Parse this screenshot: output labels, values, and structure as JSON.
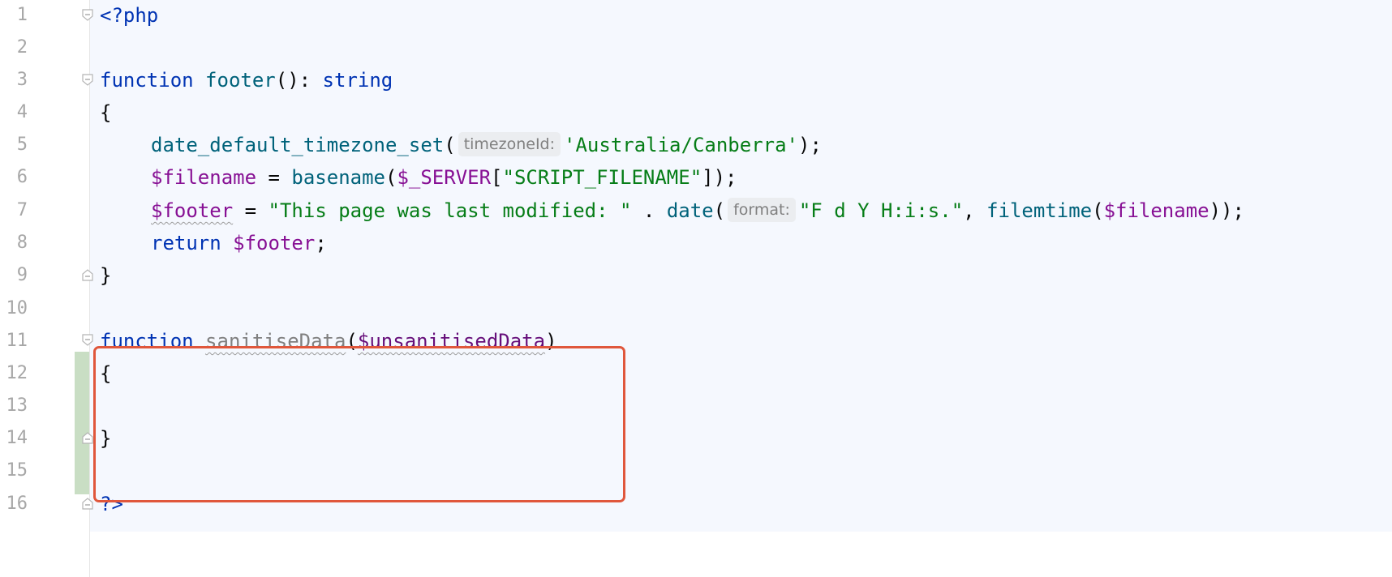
{
  "editor": {
    "language": "PHP",
    "lines": [
      {
        "n": "1"
      },
      {
        "n": "2"
      },
      {
        "n": "3"
      },
      {
        "n": "4"
      },
      {
        "n": "5"
      },
      {
        "n": "6"
      },
      {
        "n": "7"
      },
      {
        "n": "8"
      },
      {
        "n": "9"
      },
      {
        "n": "10"
      },
      {
        "n": "11"
      },
      {
        "n": "12"
      },
      {
        "n": "13"
      },
      {
        "n": "14"
      },
      {
        "n": "15"
      },
      {
        "n": "16"
      }
    ],
    "code": {
      "l1_open_tag": "<?php",
      "l3_function": "function",
      "l3_name": "footer",
      "l3_sig": "(): ",
      "l3_type": "string",
      "l4_brace": "{",
      "l5_call": "date_default_timezone_set",
      "l5_paren": "(",
      "l5_hint": "timezoneId:",
      "l5_arg": "'Australia/Canberra'",
      "l5_end": ");",
      "l6_var": "$filename",
      "l6_eq": " = ",
      "l6_call": "basename",
      "l6_paren": "(",
      "l6_server": "$_SERVER",
      "l6_br_open": "[",
      "l6_key": "\"SCRIPT_FILENAME\"",
      "l6_end": "]);",
      "l7_var": "$footer",
      "l7_eq": " = ",
      "l7_str": "\"This page was last modified: \"",
      "l7_dot": " . ",
      "l7_call": "date",
      "l7_paren": "(",
      "l7_hint": "format:",
      "l7_fmt": "\"F d Y H:i:s.\"",
      "l7_comma": ", ",
      "l7_call2": "filemtime",
      "l7_paren2": "(",
      "l7_arg2": "$filename",
      "l7_end": "));",
      "l8_return": "return",
      "l8_var": "$footer",
      "l8_end": ";",
      "l9_brace": "}",
      "l11_function": "function",
      "l11_name": "sanitiseData",
      "l11_paren": "(",
      "l11_param": "$unsanitisedData",
      "l11_end": ")",
      "l12_brace": "{",
      "l14_brace": "}",
      "l16_close_tag": "?>"
    },
    "highlight_color": "#e0573c",
    "change_marker_color": "#c9dec4"
  }
}
